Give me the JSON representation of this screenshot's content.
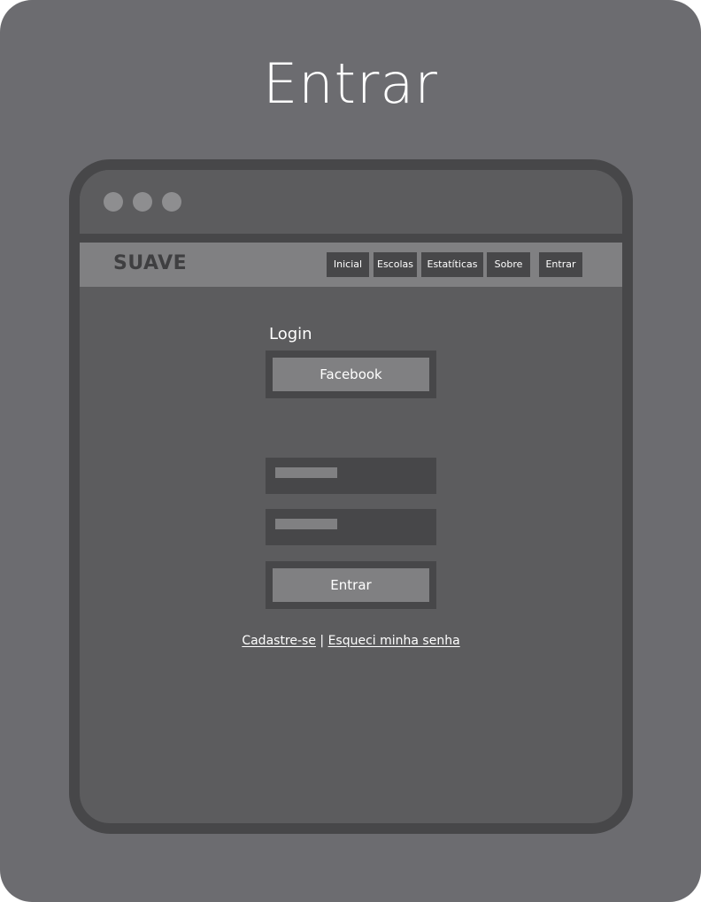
{
  "page": {
    "title": "Entrar"
  },
  "browser": {
    "window_dots": [
      "close-dot",
      "minimize-dot",
      "maximize-dot"
    ]
  },
  "navbar": {
    "brand": "SUAVE",
    "items": [
      {
        "label": "Inicial"
      },
      {
        "label": "Escolas"
      },
      {
        "label": "Estatíticas"
      },
      {
        "label": "Sobre"
      },
      {
        "label": "Entrar"
      }
    ]
  },
  "login": {
    "heading": "Login",
    "facebook_button": "Facebook",
    "username_input": {
      "value": "",
      "placeholder": ""
    },
    "password_input": {
      "value": "",
      "placeholder": ""
    },
    "submit_button": "Entrar",
    "signup_link": "Cadastre-se",
    "separator": "|",
    "forgot_link": "Esqueci minha senha"
  },
  "colors": {
    "background": "#6c6c70",
    "window_body": "#5c5c5e",
    "window_border": "#474749",
    "navbar": "#808082",
    "button_face": "#808082",
    "text": "#ffffff"
  }
}
